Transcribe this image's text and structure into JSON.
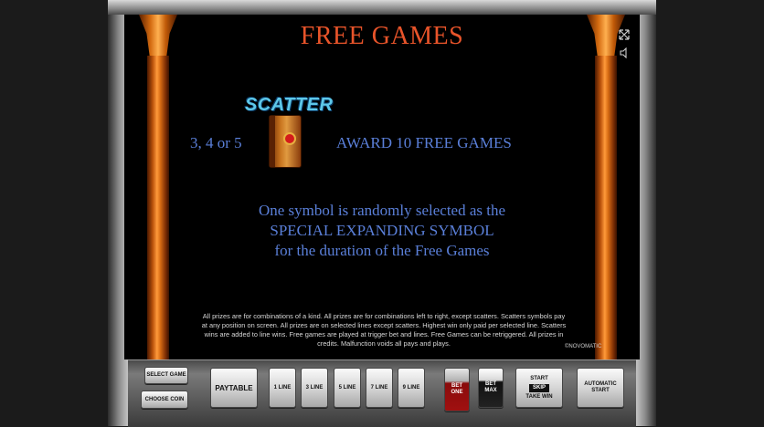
{
  "screen": {
    "title": "FREE GAMES",
    "scatter_label": "SCATTER",
    "count_text": "3, 4 or 5",
    "award_text": "AWARD 10 FREE GAMES",
    "description": [
      "One symbol is randomly selected as the",
      "SPECIAL EXPANDING SYMBOL",
      "for the duration of the Free Games"
    ],
    "fineprint": "All prizes are for combinations of a kind. All prizes are for combinations left to right, except scatters. Scatters symbols pay at any position on screen. All prizes are on selected lines except scatters. Highest win only paid per selected line. Scatters wins are added to line wins. Free games are played at trigger bet and lines. Free Games can be retriggered. All prizes in credits. Malfunction voids all pays and plays.",
    "brand": "©NOVOMATIC"
  },
  "window_controls": {
    "fullscreen_icon": "expand-icon",
    "sound_icon": "speaker-icon"
  },
  "panel": {
    "select_game": "SELECT GAME",
    "choose_coin": "CHOOSE COIN",
    "paytable": "PAYTABLE",
    "lines": [
      "1 LINE",
      "3 LINE",
      "5 LINE",
      "7 LINE",
      "9 LINE"
    ],
    "bet_one": "BET ONE",
    "bet_max": "BET MAX",
    "start": "START",
    "skip": "SKIP",
    "take_win": "TAKE WIN",
    "automatic_start": "AUTOMATIC START"
  },
  "colors": {
    "title": "#e8542a",
    "text_blue": "#5a7fd8",
    "scatter_cyan": "#5ec8e8"
  }
}
